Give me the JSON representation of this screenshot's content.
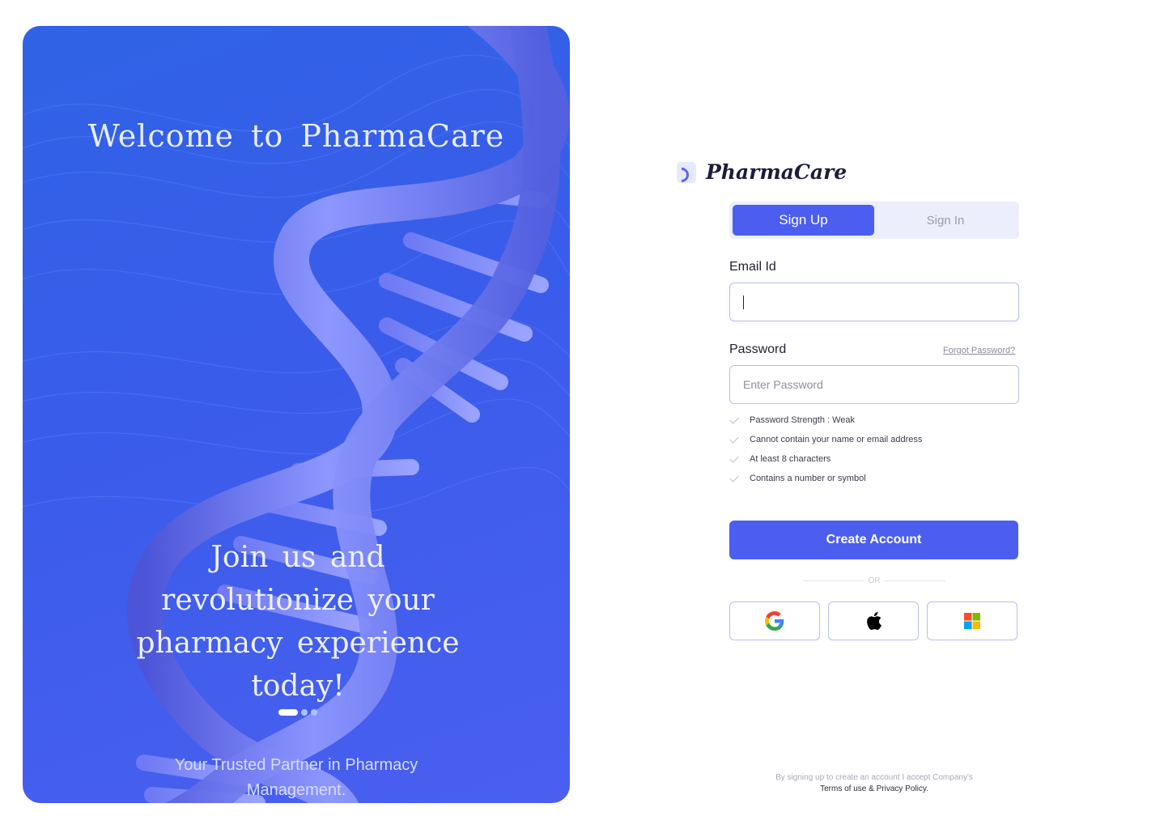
{
  "hero": {
    "title": "Welcome to PharmaCare",
    "tagline": "Join us and revolutionize your pharmacy experience today!",
    "subtitle": "Your Trusted Partner in Pharmacy Management.",
    "carousel": {
      "slides": 3,
      "active": 1
    }
  },
  "brand": {
    "name": "PharmaCare"
  },
  "tabs": {
    "signup": "Sign Up",
    "signin": "Sign In",
    "active": "signup"
  },
  "form": {
    "email_label": "Email Id",
    "email_value": "",
    "password_label": "Password",
    "forgot_label": "Forgot Password?",
    "password_placeholder": "Enter Password",
    "rules": [
      "Password Strength : Weak",
      "Cannot contain your name or email address",
      "At least 8 characters",
      "Contains a number or symbol"
    ],
    "submit_label": "Create Account",
    "or_label": "OR"
  },
  "social": [
    {
      "name": "google",
      "icon": "google-icon"
    },
    {
      "name": "apple",
      "icon": "apple-icon"
    },
    {
      "name": "microsoft",
      "icon": "microsoft-icon"
    }
  ],
  "footer": {
    "prefix": "By signing up to create an account I accept Company's",
    "links": "Terms of use & Privacy Policy."
  },
  "colors": {
    "primary": "#4b5ef0",
    "hero_blue": "#3a5cea",
    "tab_bg": "#eceefb",
    "border": "#b8bfe8"
  }
}
